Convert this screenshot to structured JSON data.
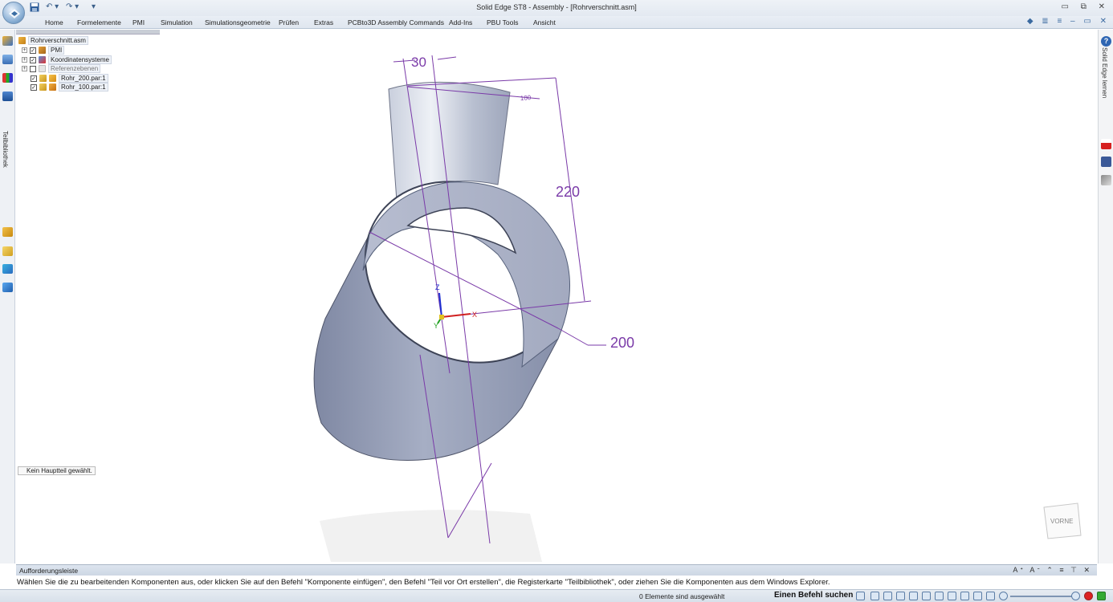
{
  "window": {
    "title": "Solid Edge ST8 - Assembly - [Rohrverschnitt.asm]",
    "controls": "▭ ⧉ ✕"
  },
  "quick_access": {
    "save_icon": "save-icon",
    "undo_icon": "undo-icon",
    "redo_icon": "redo-icon",
    "customize_glyph": "▾"
  },
  "ribbon": {
    "tabs": [
      "Home",
      "Formelemente",
      "PMI",
      "Simulation",
      "Simulationsgeometrie",
      "Prüfen",
      "Extras",
      "PCBto3D Assembly Commands",
      "Add-Ins",
      "PBU Tools",
      "Ansicht"
    ],
    "right_controls": "◆ ≣ ≡ – ▭ ✕"
  },
  "left_sidebar": {
    "label": "Teilbibliothek"
  },
  "right_sidebar": {
    "label": "Solid Edge lernen",
    "help_glyph": "?"
  },
  "tree": {
    "root": "Rohrverschnitt.asm",
    "items": [
      {
        "label": "PMI",
        "checked": true,
        "expandable": true
      },
      {
        "label": "Koordinatensysteme",
        "checked": true,
        "expandable": true
      },
      {
        "label": "Referenzebenen",
        "checked": false,
        "expandable": true
      },
      {
        "label": "Rohr_200.par:1",
        "checked": true,
        "expandable": false
      },
      {
        "label": "Rohr_100.par:1",
        "checked": true,
        "expandable": false
      }
    ],
    "check_glyph": "✓",
    "expand_glyph": "+"
  },
  "main_part_status": "Kein Hauptteil gewählt.",
  "model": {
    "dimensions": [
      "30",
      "100",
      "220",
      "200"
    ],
    "axes": {
      "x": "X",
      "y": "Y",
      "z": "Z"
    },
    "view_cube_label": "VORNE",
    "colors": {
      "dimension": "#7a3aa8",
      "tube": "#9aa4bf",
      "axis_x": "#d02020",
      "axis_y": "#20a020",
      "axis_z": "#2030d0"
    }
  },
  "prompt_bar": {
    "title": "Aufforderungsleiste",
    "controls": "Aᐩ Aᐨ ⌃ ≡ ⊤ ✕",
    "message": "Wählen Sie die zu bearbeitenden Komponenten aus, oder klicken Sie auf den Befehl \"Komponente einfügen\", den Befehl \"Teil vor Ort erstellen\", die Registerkarte \"Teilbibliothek\", oder ziehen Sie die Komponenten aus dem Windows Explorer."
  },
  "status_bar": {
    "selection": "0 Elemente sind ausgewählt",
    "command_search": "Einen Befehl suchen"
  }
}
